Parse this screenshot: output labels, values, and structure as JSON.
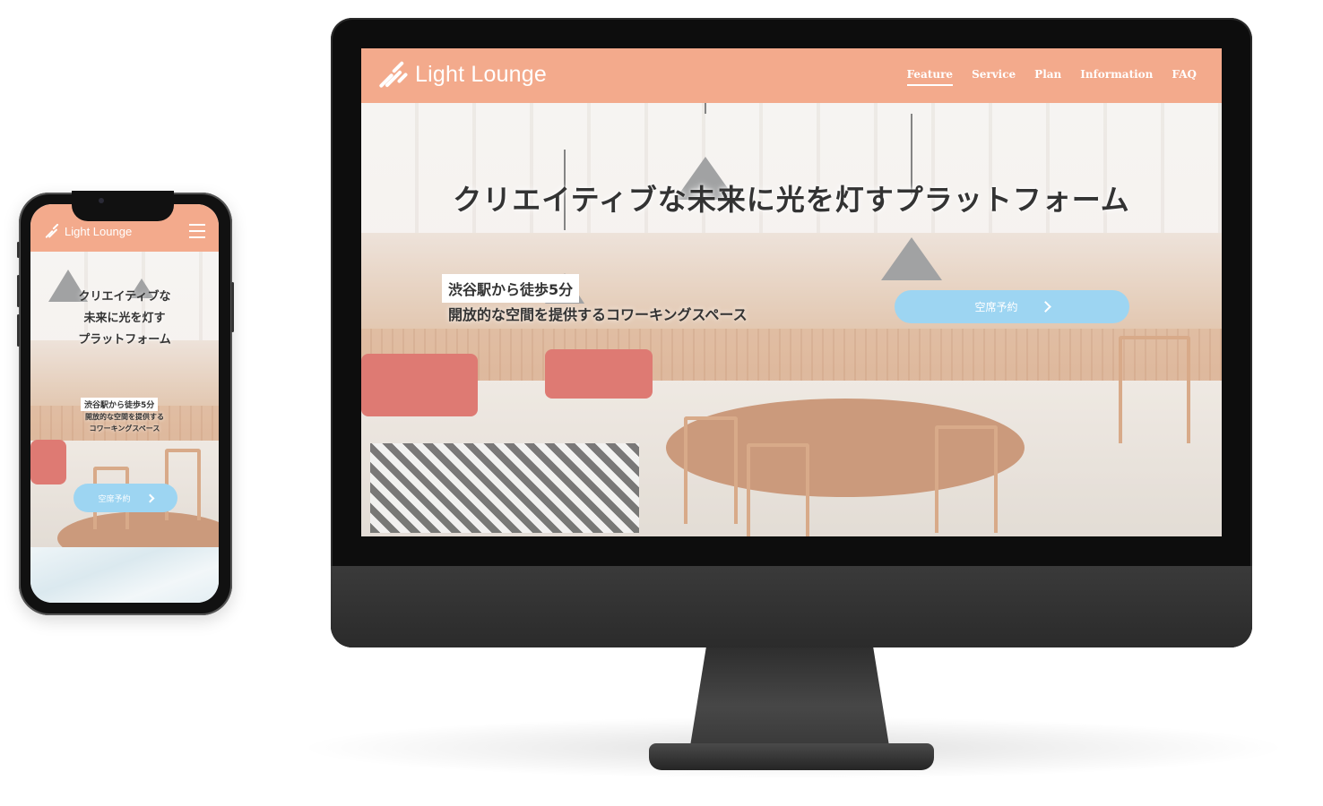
{
  "brand": {
    "name": "Light Lounge",
    "accent": "#f3aa8c",
    "button_color": "#9dd5f2"
  },
  "desktop": {
    "nav": [
      "Feature",
      "Service",
      "Plan",
      "Information",
      "FAQ"
    ],
    "active_nav": "Feature",
    "hero": {
      "title": "クリエイティブな未来に光を灯すプラットフォーム",
      "sub1": "渋谷駅から徒歩5分",
      "sub2": "開放的な空間を提供するコワーキングスペース",
      "cta": "空席予約"
    }
  },
  "mobile": {
    "menu_icon": "hamburger-icon",
    "hero": {
      "title_lines": [
        "クリエイティブな",
        "未来に光を灯す",
        "プラットフォーム"
      ],
      "sub1": "渋谷駅から徒歩5分",
      "sub2_lines": [
        "開放的な空間を提供する",
        "コワーキングスペース"
      ],
      "cta": "空席予約"
    }
  }
}
